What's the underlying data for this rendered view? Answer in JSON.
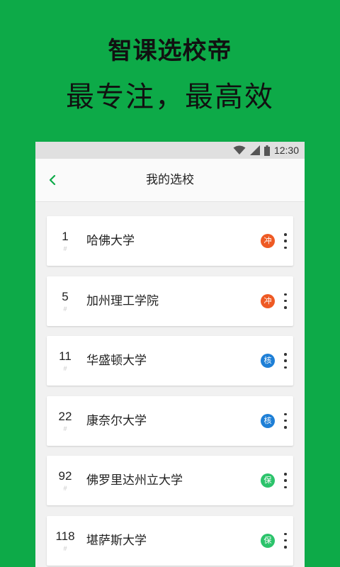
{
  "promo": {
    "title": "智课选校帝",
    "subtitle": "最专注，最高效"
  },
  "status_bar": {
    "time": "12:30",
    "icons": [
      "wifi-icon",
      "signal-icon",
      "battery-icon"
    ]
  },
  "app_bar": {
    "title": "我的选校",
    "back_icon": "chevron-left-icon"
  },
  "colors": {
    "brand_green": "#0daa48",
    "reach": "#ee5a24",
    "match": "#1e7fd6",
    "safety": "#2cc36b"
  },
  "schools": [
    {
      "rank": "1",
      "hash": "#",
      "name": "哈佛大学",
      "tag": "冲",
      "tag_color": "#ee5a24"
    },
    {
      "rank": "5",
      "hash": "#",
      "name": "加州理工学院",
      "tag": "冲",
      "tag_color": "#ee5a24"
    },
    {
      "rank": "11",
      "hash": "#",
      "name": "华盛顿大学",
      "tag": "核",
      "tag_color": "#1e7fd6"
    },
    {
      "rank": "22",
      "hash": "#",
      "name": "康奈尔大学",
      "tag": "核",
      "tag_color": "#1e7fd6"
    },
    {
      "rank": "92",
      "hash": "#",
      "name": "佛罗里达州立大学",
      "tag": "保",
      "tag_color": "#2cc36b"
    },
    {
      "rank": "118",
      "hash": "#",
      "name": "堪萨斯大学",
      "tag": "保",
      "tag_color": "#2cc36b"
    }
  ]
}
